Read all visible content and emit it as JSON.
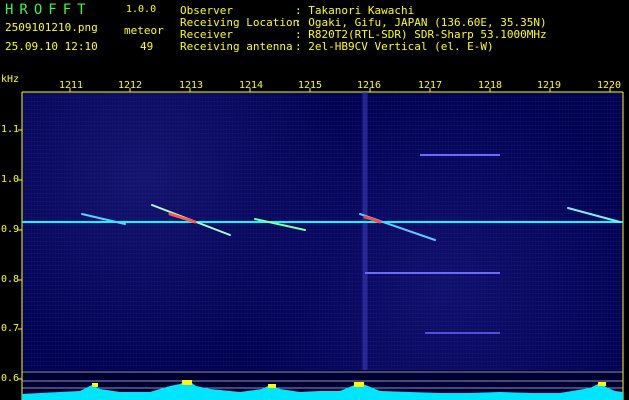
{
  "header": {
    "app_name": "HROFFT",
    "version": "1.0.0",
    "filename": "2509101210.png",
    "mode": "meteor",
    "datetime": "25.09.10 12:10",
    "count": "49",
    "info": [
      {
        "label": "Observer",
        "value": ": Takanori Kawachi"
      },
      {
        "label": "Receiving Location",
        "value": ": Ogaki, Gifu, JAPAN (136.60E, 35.35N)"
      },
      {
        "label": "Receiver",
        "value": ": R820T2(RTL-SDR) SDR-Sharp 53.1000MHz"
      },
      {
        "label": "Receiving antenna",
        "value": ": 2el-HB9CV Vertical (el. E-W)"
      }
    ]
  },
  "axis": {
    "y_unit": "kHz",
    "x_ticks": [
      "1211",
      "1212",
      "1213",
      "1214",
      "1215",
      "1216",
      "1217",
      "1218",
      "1219",
      "1220"
    ],
    "y_ticks": [
      "1.1",
      "1.0",
      "0.9",
      "0.8",
      "0.7",
      "0.6"
    ]
  },
  "colors": {
    "text": "#ffff00",
    "background": "#000052",
    "carrier": "#00ffff",
    "bars": "#00e5ff",
    "bar_peak": "#ffff00"
  }
}
